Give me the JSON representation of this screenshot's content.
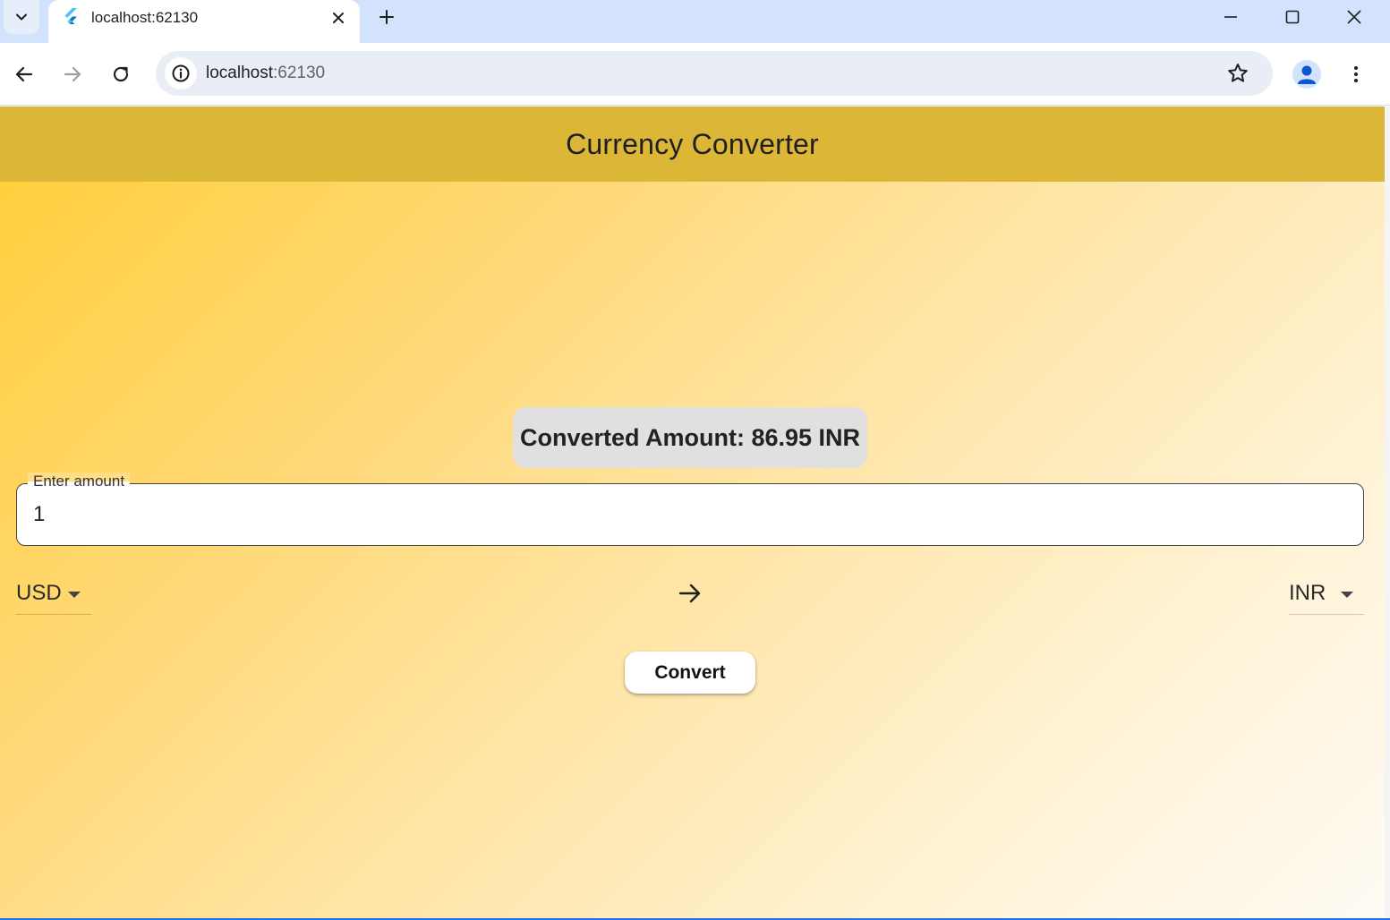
{
  "browser": {
    "tab": {
      "title": "localhost:62130",
      "active": true
    },
    "omnibox": {
      "host": "localhost",
      "port": ":62130"
    }
  },
  "app": {
    "appbar": {
      "title": "Currency Converter"
    },
    "result": {
      "text": "Converted Amount: 86.95 INR"
    },
    "amount_input": {
      "label": "Enter amount",
      "value": "1"
    },
    "from_currency": {
      "selected": "USD"
    },
    "to_currency": {
      "selected": "INR"
    },
    "convert_button": {
      "label": "Convert"
    }
  },
  "colors": {
    "appbar": "#dcb636",
    "gradient_start": "#ffcf3d",
    "gradient_end": "#fffbf4",
    "result_card": "#e0e0e0",
    "tabstrip": "#d3e3fd"
  }
}
